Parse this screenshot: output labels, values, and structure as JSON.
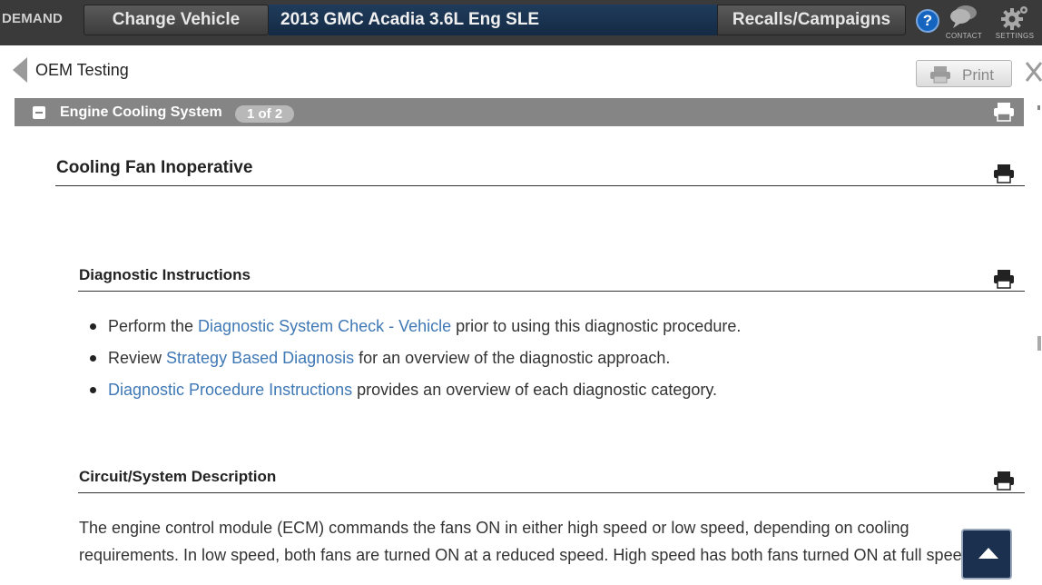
{
  "topbar": {
    "brand": "DEMAND",
    "change_vehicle": "Change Vehicle",
    "vehicle": "2013 GMC Acadia 3.6L Eng SLE",
    "recalls": "Recalls/Campaigns",
    "help": "?",
    "contact_label": "CONTACT",
    "settings_label": "SETTINGS"
  },
  "subheader": {
    "title": "OEM Testing",
    "print_label": "Print"
  },
  "section": {
    "title": "Engine Cooling System",
    "badge": "1 of 2"
  },
  "document": {
    "title": "Cooling Fan Inoperative",
    "diagnostic": {
      "heading": "Diagnostic Instructions",
      "items": [
        {
          "before": "Perform the ",
          "link": "Diagnostic System Check - Vehicle",
          "after": " prior to using this diagnostic procedure."
        },
        {
          "before": "Review ",
          "link": "Strategy Based Diagnosis",
          "after": " for an overview of the diagnostic approach."
        },
        {
          "before": "",
          "link": "Diagnostic Procedure Instructions",
          "after": " provides an overview of each diagnostic category."
        }
      ]
    },
    "circuit": {
      "heading": "Circuit/System Description",
      "line1": "The engine control module (ECM) commands the fans ON in either high speed or low speed, depending on cooling",
      "line2": "requirements. In low speed, both fans are turned ON at a reduced speed. High speed has both fans turned ON at full speed."
    }
  },
  "colors": {
    "topbar_bg": "#3a3a3a",
    "vehicle_field_bg": "#1f3c5c",
    "section_bar_bg": "#858585",
    "link": "#3f78b5",
    "help_blue": "#1565c0",
    "scroll_top_bg": "#1b2f4e"
  },
  "icons": [
    "contact-icon",
    "settings-icon",
    "help-icon",
    "back-arrow-icon",
    "printer-icon",
    "close-icon",
    "collapse-icon",
    "scroll-to-top-icon"
  ]
}
